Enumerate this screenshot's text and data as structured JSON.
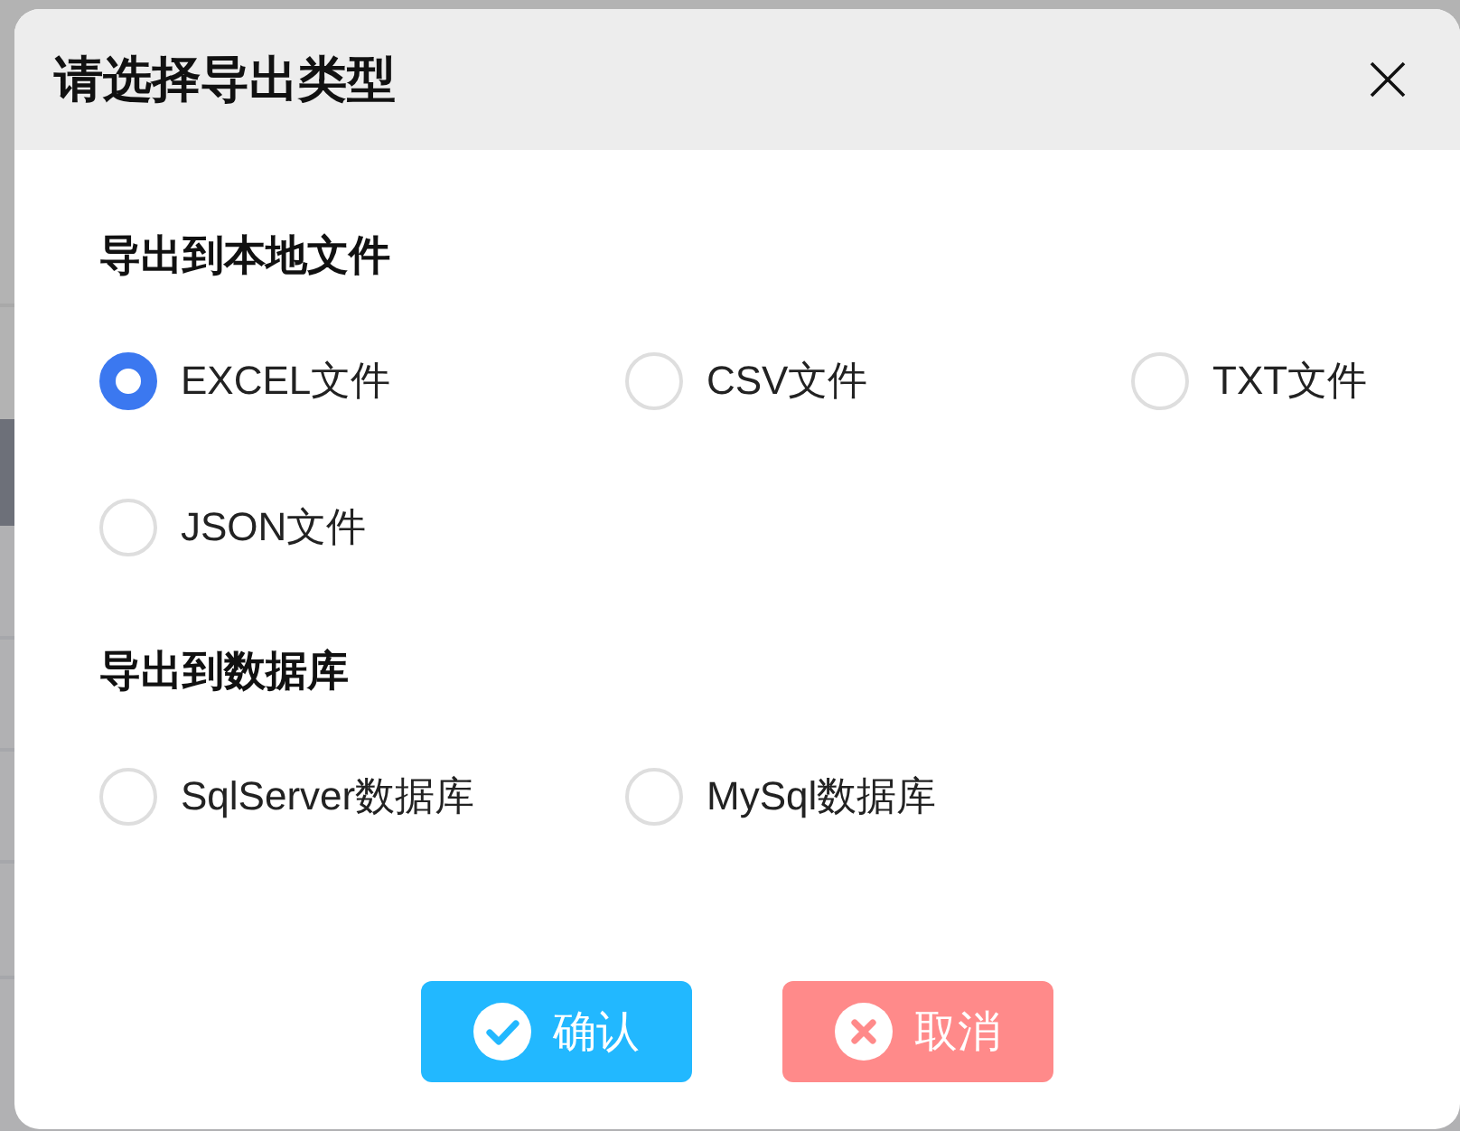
{
  "dialog": {
    "title": "请选择导出类型"
  },
  "sections": [
    {
      "heading": "导出到本地文件",
      "options": [
        {
          "label": "EXCEL文件",
          "selected": true
        },
        {
          "label": "CSV文件",
          "selected": false
        },
        {
          "label": "TXT文件",
          "selected": false
        },
        {
          "label": "JSON文件",
          "selected": false
        }
      ]
    },
    {
      "heading": "导出到数据库",
      "options": [
        {
          "label": "SqlServer数据库",
          "selected": false
        },
        {
          "label": "MySql数据库",
          "selected": false
        }
      ]
    }
  ],
  "buttons": [
    {
      "kind": "confirm",
      "label": "确认"
    },
    {
      "kind": "cancel",
      "label": "取消"
    }
  ]
}
